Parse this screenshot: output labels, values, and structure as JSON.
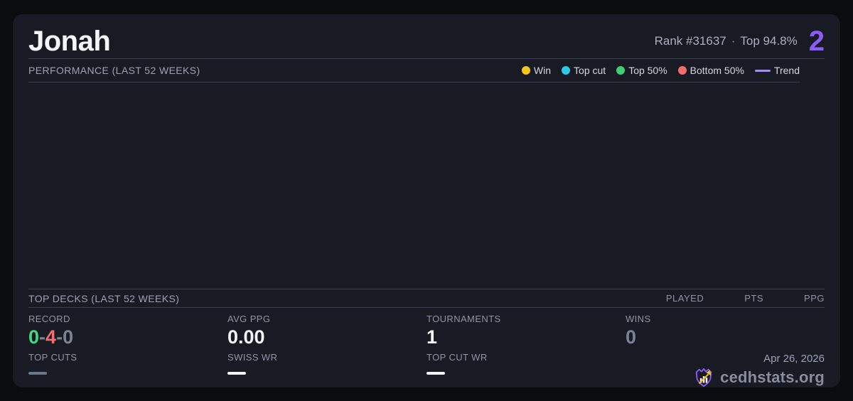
{
  "header": {
    "player_name": "Jonah",
    "rank": "Rank #31637",
    "separator": "·",
    "top_percent": "Top 94.8%",
    "badge_value": "2"
  },
  "performance": {
    "title": "PERFORMANCE (LAST 52 WEEKS)",
    "chart_empty": true,
    "legend": [
      {
        "label": "Win",
        "color": "#f2c51d",
        "type": "dot"
      },
      {
        "label": "Top cut",
        "color": "#2cc9e8",
        "type": "dot"
      },
      {
        "label": "Top 50%",
        "color": "#3ecf73",
        "type": "dot"
      },
      {
        "label": "Bottom 50%",
        "color": "#f06e6e",
        "type": "dot"
      },
      {
        "label": "Trend",
        "color": "#a78bfa",
        "type": "line"
      }
    ]
  },
  "top_decks": {
    "title": "TOP DECKS (LAST 52 WEEKS)",
    "columns": {
      "played": "PLAYED",
      "pts": "PTS",
      "ppg": "PPG"
    },
    "rows": []
  },
  "stats": {
    "record": {
      "label": "RECORD",
      "wins": "0",
      "losses": "4",
      "draws": "0",
      "separator": "-"
    },
    "avg_ppg": {
      "label": "AVG PPG",
      "value": "0.00"
    },
    "tournaments": {
      "label": "TOURNAMENTS",
      "value": "1"
    },
    "wins": {
      "label": "WINS",
      "value": "0"
    },
    "top_cuts": {
      "label": "TOP CUTS",
      "value": "—"
    },
    "swiss_wr": {
      "label": "SWISS WR",
      "value": "—"
    },
    "top_cut_wr": {
      "label": "TOP CUT WR",
      "value": "—"
    }
  },
  "footer": {
    "date": "Apr 26, 2026",
    "brand": "cedhstats.org"
  },
  "colors": {
    "background": "#0b0c10",
    "card": "#191b24",
    "accent_purple": "#8b5cf6",
    "trend_purple": "#a78bfa",
    "win_yellow": "#f2c51d",
    "topcut_cyan": "#2cc9e8",
    "top50_green": "#3ecf73",
    "bottom50_red": "#f06e6e",
    "record_green": "#44d97c",
    "record_red": "#f26d6d",
    "muted_gray": "#7b8396"
  }
}
